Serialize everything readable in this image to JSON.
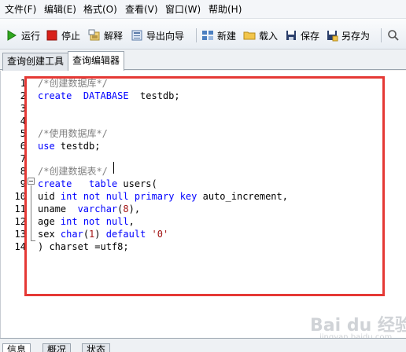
{
  "menu": [
    {
      "label": "文件(F)"
    },
    {
      "label": "编辑(E)"
    },
    {
      "label": "格式(O)"
    },
    {
      "label": "查看(V)"
    },
    {
      "label": "窗口(W)"
    },
    {
      "label": "帮助(H)"
    }
  ],
  "toolbar": {
    "run_label": "运行",
    "stop_label": "停止",
    "explain_label": "解释",
    "export_wizard_label": "导出向导",
    "new_label": "新建",
    "load_label": "载入",
    "save_label": "保存",
    "save_as_label": "另存为",
    "icons": {
      "run": "play-icon",
      "stop": "stop-icon",
      "explain": "explain-icon",
      "export": "export-icon",
      "new": "new-icon",
      "load": "folder-icon",
      "save": "save-icon",
      "save_as": "save-as-icon",
      "search": "search-icon"
    }
  },
  "tabs": [
    {
      "label": "查询创建工具",
      "active": false
    },
    {
      "label": "查询编辑器",
      "active": true
    }
  ],
  "editor": {
    "line_numbers": [
      "1",
      "2",
      "3",
      "4",
      "5",
      "6",
      "7",
      "8",
      "9",
      "10",
      "11",
      "12",
      "13",
      "14"
    ],
    "lines": [
      [
        {
          "t": "/*创建数据库*/",
          "c": "cm"
        }
      ],
      [
        {
          "t": "create",
          "c": "kw"
        },
        {
          "t": "  "
        },
        {
          "t": "DATABASE",
          "c": "kw"
        },
        {
          "t": "  testdb;"
        }
      ],
      [],
      [],
      [
        {
          "t": "/*使用数据库*/",
          "c": "cm"
        }
      ],
      [
        {
          "t": "use",
          "c": "kw"
        },
        {
          "t": " testdb;"
        }
      ],
      [],
      [
        {
          "t": "/*创建数据表*/",
          "c": "cm"
        }
      ],
      [
        {
          "t": "create",
          "c": "kw"
        },
        {
          "t": "   "
        },
        {
          "t": "table",
          "c": "kw"
        },
        {
          "t": " users("
        }
      ],
      [
        {
          "t": "uid "
        },
        {
          "t": "int",
          "c": "kw"
        },
        {
          "t": " "
        },
        {
          "t": "not",
          "c": "kw"
        },
        {
          "t": " "
        },
        {
          "t": "null",
          "c": "kw"
        },
        {
          "t": " "
        },
        {
          "t": "primary",
          "c": "kw"
        },
        {
          "t": " "
        },
        {
          "t": "key",
          "c": "kw"
        },
        {
          "t": " auto_increment,"
        }
      ],
      [
        {
          "t": "uname  "
        },
        {
          "t": "varchar",
          "c": "kw"
        },
        {
          "t": "("
        },
        {
          "t": "8",
          "c": "str"
        },
        {
          "t": "),"
        }
      ],
      [
        {
          "t": "age "
        },
        {
          "t": "int",
          "c": "kw"
        },
        {
          "t": " "
        },
        {
          "t": "not",
          "c": "kw"
        },
        {
          "t": " "
        },
        {
          "t": "null",
          "c": "kw"
        },
        {
          "t": ","
        }
      ],
      [
        {
          "t": "sex "
        },
        {
          "t": "char",
          "c": "kw"
        },
        {
          "t": "("
        },
        {
          "t": "1",
          "c": "str"
        },
        {
          "t": ") "
        },
        {
          "t": "default",
          "c": "kw"
        },
        {
          "t": " "
        },
        {
          "t": "'0'",
          "c": "str"
        }
      ],
      [
        {
          "t": ") charset =utf8;"
        }
      ]
    ]
  },
  "bottom_tabs": [
    {
      "label": "信息",
      "active": true
    },
    {
      "label": "概况",
      "active": false
    },
    {
      "label": "状态",
      "active": false
    }
  ],
  "watermark": {
    "brand": "Bai du 经验",
    "sub": "jingyan.baidu.com"
  },
  "colors": {
    "keyword": "#0000ff",
    "comment": "#808080",
    "string": "#a31515",
    "highlight_box": "#e53935"
  }
}
